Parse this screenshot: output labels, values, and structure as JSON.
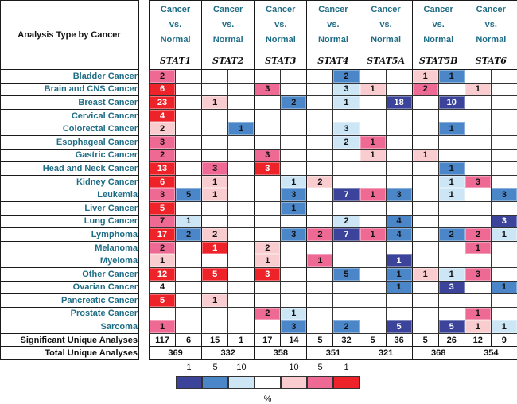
{
  "chart_data": {
    "type": "heatmap",
    "title": "",
    "row_header": "Analysis Type by Cancer",
    "comparison_label": "Cancer vs. Normal",
    "comparison_lines": [
      "Cancer",
      "vs.",
      "Normal"
    ],
    "genes": [
      "STAT1",
      "STAT2",
      "STAT3",
      "STAT4",
      "STAT5A",
      "STAT5B",
      "STAT6"
    ],
    "subcolumns": [
      "up",
      "down"
    ],
    "rows": [
      "Bladder Cancer",
      "Brain and CNS Cancer",
      "Breast Cancer",
      "Cervical Cancer",
      "Colorectal Cancer",
      "Esophageal Cancer",
      "Gastric Cancer",
      "Head and Neck Cancer",
      "Kidney Cancer",
      "Leukemia",
      "Liver Cancer",
      "Lung Cancer",
      "Lymphoma",
      "Melanoma",
      "Myeloma",
      "Other Cancer",
      "Ovarian Cancer",
      "Pancreatic Cancer",
      "Prostate Cancer",
      "Sarcoma"
    ],
    "color_legend": {
      "labels_down": [
        "1",
        "5",
        "10"
      ],
      "labels_up": [
        "10",
        "5",
        "1"
      ],
      "unit": "%",
      "colors": {
        "down_1": "#3b449a",
        "down_5": "#4a86c8",
        "down_10": "#cde6f6",
        "none": "#ffffff",
        "up_10": "#f9cccf",
        "up_5": "#ee6a95",
        "up_1": "#ee2229"
      }
    },
    "cells": [
      [
        {
          "v": "2",
          "c": "up_5"
        },
        null,
        null,
        null,
        null,
        null,
        null,
        {
          "v": "2",
          "c": "down_5"
        },
        null,
        null,
        {
          "v": "1",
          "c": "up_10"
        },
        {
          "v": "1",
          "c": "down_5"
        },
        null,
        null
      ],
      [
        {
          "v": "6",
          "c": "up_1"
        },
        null,
        null,
        null,
        {
          "v": "3",
          "c": "up_5"
        },
        null,
        null,
        {
          "v": "3",
          "c": "down_10"
        },
        {
          "v": "1",
          "c": "up_10"
        },
        null,
        {
          "v": "2",
          "c": "up_5"
        },
        null,
        {
          "v": "1",
          "c": "up_10"
        },
        null
      ],
      [
        {
          "v": "23",
          "c": "up_1"
        },
        null,
        {
          "v": "1",
          "c": "up_10"
        },
        null,
        null,
        {
          "v": "2",
          "c": "down_5"
        },
        null,
        {
          "v": "1",
          "c": "down_10"
        },
        null,
        {
          "v": "18",
          "c": "down_1"
        },
        null,
        {
          "v": "10",
          "c": "down_1"
        },
        null,
        null
      ],
      [
        {
          "v": "4",
          "c": "up_1"
        },
        null,
        null,
        null,
        null,
        null,
        null,
        null,
        null,
        null,
        null,
        null,
        null,
        null
      ],
      [
        {
          "v": "2",
          "c": "up_10"
        },
        null,
        null,
        {
          "v": "1",
          "c": "down_5"
        },
        null,
        null,
        null,
        {
          "v": "3",
          "c": "down_10"
        },
        null,
        null,
        null,
        {
          "v": "1",
          "c": "down_5"
        },
        null,
        null
      ],
      [
        {
          "v": "3",
          "c": "up_5"
        },
        null,
        null,
        null,
        null,
        null,
        null,
        {
          "v": "2",
          "c": "down_10"
        },
        {
          "v": "1",
          "c": "up_5"
        },
        null,
        null,
        null,
        null,
        null
      ],
      [
        {
          "v": "2",
          "c": "up_5"
        },
        null,
        null,
        null,
        {
          "v": "3",
          "c": "up_5"
        },
        null,
        null,
        null,
        {
          "v": "1",
          "c": "up_10"
        },
        null,
        {
          "v": "1",
          "c": "up_10"
        },
        null,
        null,
        null
      ],
      [
        {
          "v": "13",
          "c": "up_1"
        },
        null,
        {
          "v": "3",
          "c": "up_5"
        },
        null,
        {
          "v": "3",
          "c": "up_1"
        },
        null,
        null,
        null,
        null,
        null,
        null,
        {
          "v": "1",
          "c": "down_5"
        },
        null,
        null
      ],
      [
        {
          "v": "6",
          "c": "up_1"
        },
        null,
        {
          "v": "1",
          "c": "up_10"
        },
        null,
        null,
        {
          "v": "1",
          "c": "down_10"
        },
        {
          "v": "2",
          "c": "up_10"
        },
        null,
        null,
        null,
        null,
        {
          "v": "1",
          "c": "down_10"
        },
        {
          "v": "3",
          "c": "up_5"
        },
        null
      ],
      [
        {
          "v": "3",
          "c": "up_5"
        },
        {
          "v": "5",
          "c": "down_5"
        },
        {
          "v": "1",
          "c": "up_10"
        },
        null,
        null,
        {
          "v": "3",
          "c": "down_5"
        },
        null,
        {
          "v": "7",
          "c": "down_1"
        },
        {
          "v": "1",
          "c": "up_5"
        },
        {
          "v": "3",
          "c": "down_5"
        },
        null,
        {
          "v": "1",
          "c": "down_10"
        },
        null,
        {
          "v": "3",
          "c": "down_5"
        }
      ],
      [
        {
          "v": "5",
          "c": "up_1"
        },
        null,
        null,
        null,
        null,
        {
          "v": "1",
          "c": "down_5"
        },
        null,
        null,
        null,
        null,
        null,
        null,
        null,
        null
      ],
      [
        {
          "v": "7",
          "c": "up_5"
        },
        {
          "v": "1",
          "c": "down_10"
        },
        null,
        null,
        null,
        null,
        null,
        {
          "v": "2",
          "c": "down_10"
        },
        null,
        {
          "v": "4",
          "c": "down_5"
        },
        null,
        null,
        null,
        {
          "v": "3",
          "c": "down_1"
        }
      ],
      [
        {
          "v": "17",
          "c": "up_1"
        },
        {
          "v": "2",
          "c": "down_5"
        },
        {
          "v": "2",
          "c": "up_10"
        },
        null,
        null,
        {
          "v": "3",
          "c": "down_5"
        },
        {
          "v": "2",
          "c": "up_5"
        },
        {
          "v": "7",
          "c": "down_1"
        },
        {
          "v": "1",
          "c": "up_5"
        },
        {
          "v": "4",
          "c": "down_5"
        },
        null,
        {
          "v": "2",
          "c": "down_5"
        },
        {
          "v": "2",
          "c": "up_5"
        },
        {
          "v": "1",
          "c": "down_10"
        }
      ],
      [
        {
          "v": "2",
          "c": "up_5"
        },
        null,
        {
          "v": "1",
          "c": "up_1"
        },
        null,
        {
          "v": "2",
          "c": "up_10"
        },
        null,
        null,
        null,
        null,
        null,
        null,
        null,
        {
          "v": "1",
          "c": "up_5"
        },
        null
      ],
      [
        {
          "v": "1",
          "c": "up_10"
        },
        null,
        null,
        null,
        {
          "v": "1",
          "c": "up_10"
        },
        null,
        {
          "v": "1",
          "c": "up_5"
        },
        null,
        null,
        {
          "v": "1",
          "c": "down_1"
        },
        null,
        null,
        null,
        null
      ],
      [
        {
          "v": "12",
          "c": "up_1"
        },
        null,
        {
          "v": "5",
          "c": "up_1"
        },
        null,
        {
          "v": "3",
          "c": "up_1"
        },
        null,
        null,
        {
          "v": "5",
          "c": "down_5"
        },
        null,
        {
          "v": "1",
          "c": "down_5"
        },
        {
          "v": "1",
          "c": "up_10"
        },
        {
          "v": "1",
          "c": "down_10"
        },
        {
          "v": "3",
          "c": "up_5"
        },
        null
      ],
      [
        {
          "v": "4",
          "c": "none"
        },
        null,
        null,
        null,
        null,
        null,
        null,
        null,
        null,
        {
          "v": "1",
          "c": "down_5"
        },
        null,
        {
          "v": "3",
          "c": "down_1"
        },
        null,
        {
          "v": "1",
          "c": "down_5"
        }
      ],
      [
        {
          "v": "5",
          "c": "up_1"
        },
        null,
        {
          "v": "1",
          "c": "up_10"
        },
        null,
        null,
        null,
        null,
        null,
        null,
        null,
        null,
        null,
        null,
        null
      ],
      [
        null,
        null,
        null,
        null,
        {
          "v": "2",
          "c": "up_5"
        },
        {
          "v": "1",
          "c": "down_10"
        },
        null,
        null,
        null,
        null,
        null,
        null,
        {
          "v": "1",
          "c": "up_5"
        },
        null
      ],
      [
        {
          "v": "1",
          "c": "up_5"
        },
        null,
        null,
        null,
        null,
        {
          "v": "3",
          "c": "down_5"
        },
        null,
        {
          "v": "2",
          "c": "down_5"
        },
        null,
        {
          "v": "5",
          "c": "down_1"
        },
        null,
        {
          "v": "5",
          "c": "down_1"
        },
        {
          "v": "1",
          "c": "up_10"
        },
        {
          "v": "1",
          "c": "down_10"
        }
      ]
    ],
    "significant_label": "Significant Unique Analyses",
    "significant": [
      "117",
      "6",
      "15",
      "1",
      "17",
      "14",
      "5",
      "32",
      "5",
      "36",
      "5",
      "26",
      "12",
      "9"
    ],
    "total_label": "Total Unique Analyses",
    "total": [
      "369",
      "332",
      "358",
      "351",
      "321",
      "368",
      "354"
    ]
  }
}
